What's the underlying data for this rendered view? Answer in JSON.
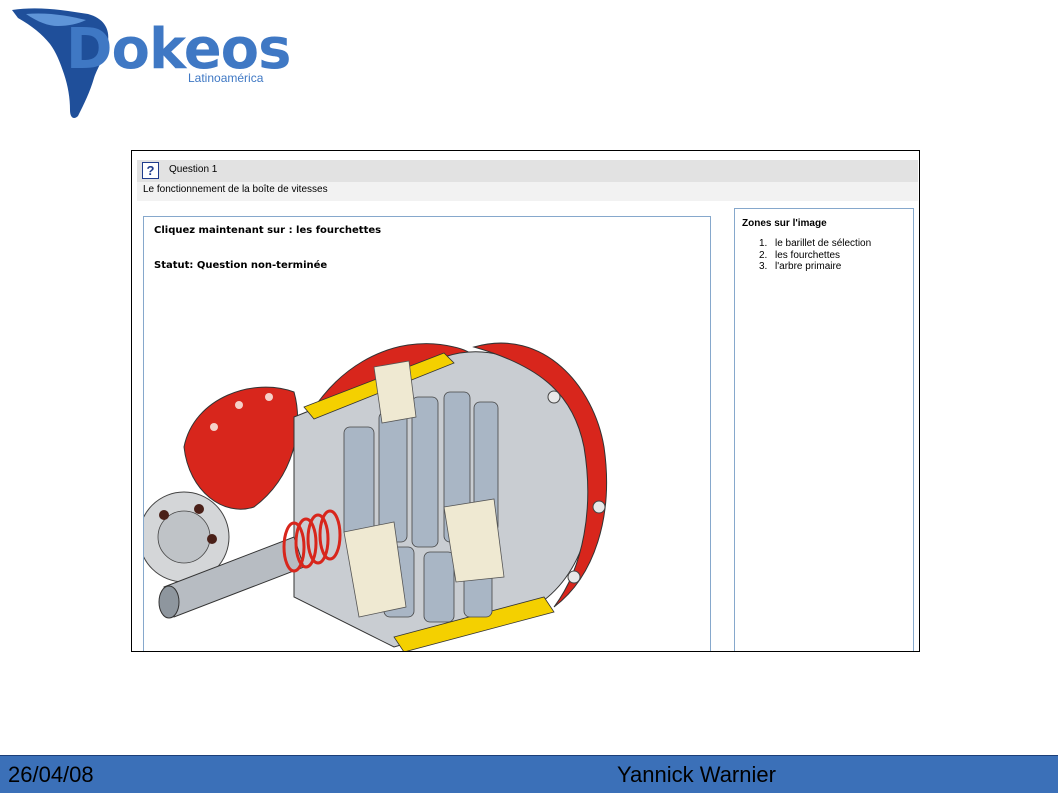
{
  "logo": {
    "name": "Dokeos",
    "subtitle": "Latinoamérica",
    "color": "#3f78c4"
  },
  "question": {
    "icon": "question-icon",
    "title": "Question 1",
    "description": "Le fonctionnement de la boîte de vitesses",
    "instruction": "Cliquez maintenant sur : les fourchettes",
    "status": "Statut: Question non-terminée"
  },
  "zones": {
    "title": "Zones sur l'image",
    "items": [
      {
        "num": "1.",
        "label": "le barillet de sélection"
      },
      {
        "num": "2.",
        "label": "les fourchettes"
      },
      {
        "num": "3.",
        "label": "l'arbre primaire"
      }
    ]
  },
  "footer": {
    "date": "26/04/08",
    "author": "Yannick Warnier",
    "color": "#3b70b8"
  },
  "colors": {
    "panel_border": "#86a8cc",
    "question_bar": "#e2e2e2",
    "housing_red": "#d8261c",
    "housing_yellow": "#f4d000"
  }
}
